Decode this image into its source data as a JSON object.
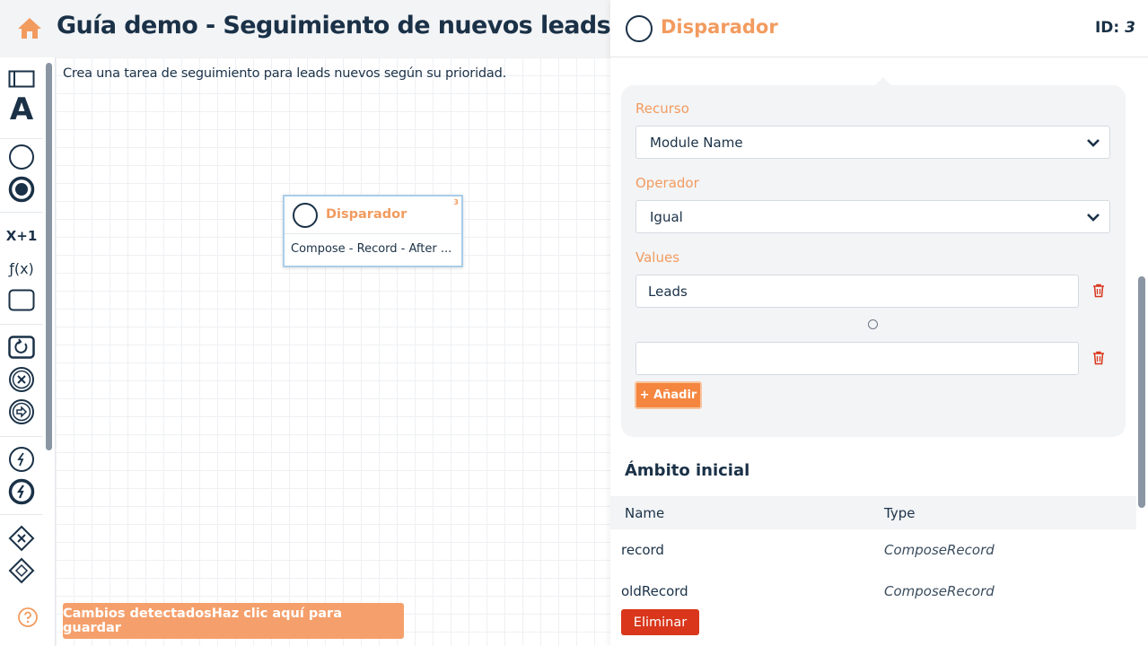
{
  "header": {
    "title": "Guía demo - Seguimiento de nuevos leads"
  },
  "canvas": {
    "description": "Crea una tarea de seguimiento para leads nuevos según su prioridad.",
    "node": {
      "title": "Disparador",
      "id": "3",
      "subtitle": "Compose - Record - After ..."
    },
    "save_banner": "Cambios detectadosHaz clic aquí para guardar"
  },
  "toolbar": {
    "tools": [
      {
        "name": "swimlane-tool-icon"
      },
      {
        "name": "text-tool",
        "label": "A"
      },
      {
        "name": "start-event-icon"
      },
      {
        "name": "end-event-icon"
      },
      {
        "name": "expression-tool",
        "label": "X+1"
      },
      {
        "name": "function-tool",
        "label": "ƒ(x)"
      },
      {
        "name": "task-tool-icon"
      },
      {
        "name": "loop-tool-icon"
      },
      {
        "name": "error-tool-icon"
      },
      {
        "name": "continue-tool-icon"
      },
      {
        "name": "event-tool-icon"
      },
      {
        "name": "event-filled-tool-icon"
      },
      {
        "name": "exclusive-gateway-icon"
      },
      {
        "name": "inclusive-gateway-icon"
      },
      {
        "name": "help-icon"
      }
    ]
  },
  "panel": {
    "title": "Disparador",
    "id_label": "ID:",
    "id_value": "3",
    "resource_label": "Recurso",
    "resource_value": "Module Name",
    "operator_label": "Operador",
    "operator_value": "Igual",
    "values_label": "Values",
    "values": [
      "Leads",
      ""
    ],
    "add_label": "+ Añadir",
    "scope_title": "Ámbito inicial",
    "scope_headers": {
      "name": "Name",
      "type": "Type"
    },
    "scope_rows": [
      {
        "name": "record",
        "type": "ComposeRecord"
      },
      {
        "name": "oldRecord",
        "type": "ComposeRecord"
      }
    ],
    "delete_label": "Eliminar"
  },
  "colors": {
    "accent": "#f29b5f",
    "navy": "#1a3147",
    "danger": "#d9361b"
  }
}
